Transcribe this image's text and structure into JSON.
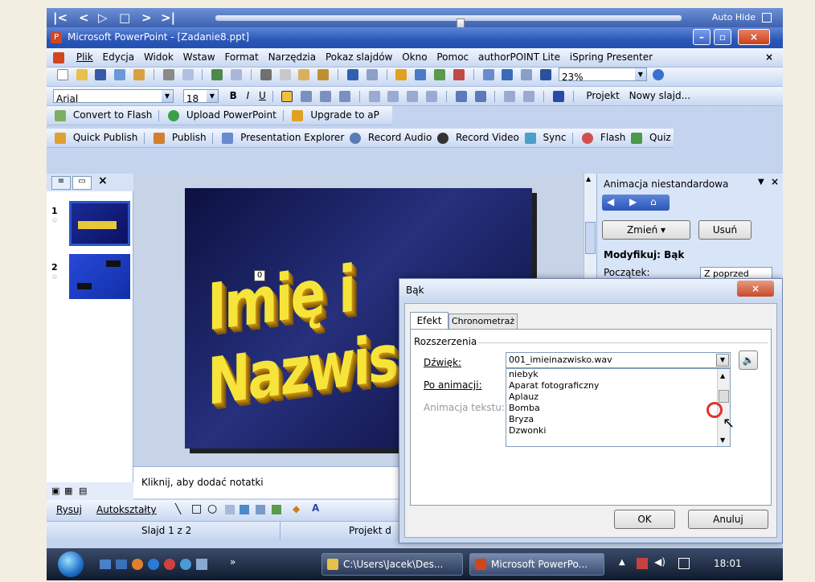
{
  "player": {
    "auto_hide": "Auto Hide"
  },
  "window": {
    "title": "Microsoft PowerPoint - [Zadanie8.ppt]"
  },
  "menu": [
    "Plik",
    "Edycja",
    "Widok",
    "Wstaw",
    "Format",
    "Narzędzia",
    "Pokaz slajdów",
    "Okno",
    "Pomoc",
    "authorPOINT Lite",
    "iSpring Presenter"
  ],
  "standard_toolbar": {
    "zoom": "23%"
  },
  "format_toolbar": {
    "font": "Arial",
    "size": "18",
    "bold": "B",
    "italic": "I",
    "underline": "U",
    "projekt": "Projekt",
    "new_slide": "Nowy slajd..."
  },
  "flash_toolbar": {
    "convert": "Convert to Flash",
    "upload": "Upload PowerPoint",
    "upgrade": "Upgrade to aP"
  },
  "ispring_toolbar": {
    "quick_publish": "Quick Publish",
    "publish": "Publish",
    "explorer": "Presentation Explorer",
    "record_audio": "Record Audio",
    "record_video": "Record Video",
    "sync": "Sync",
    "flash": "Flash",
    "quiz": "Quiz"
  },
  "slides_pane": {
    "slide1_num": "1",
    "slide2_num": "2"
  },
  "slide": {
    "title": "Imię i Nazwisko",
    "anim_tag": "0"
  },
  "notes": {
    "placeholder": "Kliknij, aby dodać notatki"
  },
  "task_pane": {
    "title": "Animacja niestandardowa",
    "change": "Zmień",
    "remove": "Usuń",
    "modify_label": "Modyfikuj: Bąk",
    "start_label": "Początek:",
    "start_value": "Z poprzed"
  },
  "draw_toolbar": {
    "draw": "Rysuj",
    "autoshapes": "Autokształty"
  },
  "status": {
    "slide": "Slajd 1 z 2",
    "design": "Projekt d"
  },
  "dialog": {
    "title": "Bąk",
    "tab_effect": "Efekt",
    "tab_timing": "Chronometraż",
    "group_label": "Rozszerzenia",
    "sound_label": "Dźwięk:",
    "sound_value": "001_imieinazwisko.wav",
    "after_label": "Po animacji:",
    "text_label": "Animacja tekstu:",
    "sound_options": [
      "niebyk",
      "Aparat fotograficzny",
      "Aplauz",
      "Bomba",
      "Bryza",
      "Dzwonki"
    ],
    "ok": "OK",
    "cancel": "Anuluj"
  },
  "taskbar": {
    "explorer_window": "C:\\Users\\Jacek\\Des...",
    "ppt_window": "Microsoft PowerPo...",
    "clock": "18:01"
  }
}
